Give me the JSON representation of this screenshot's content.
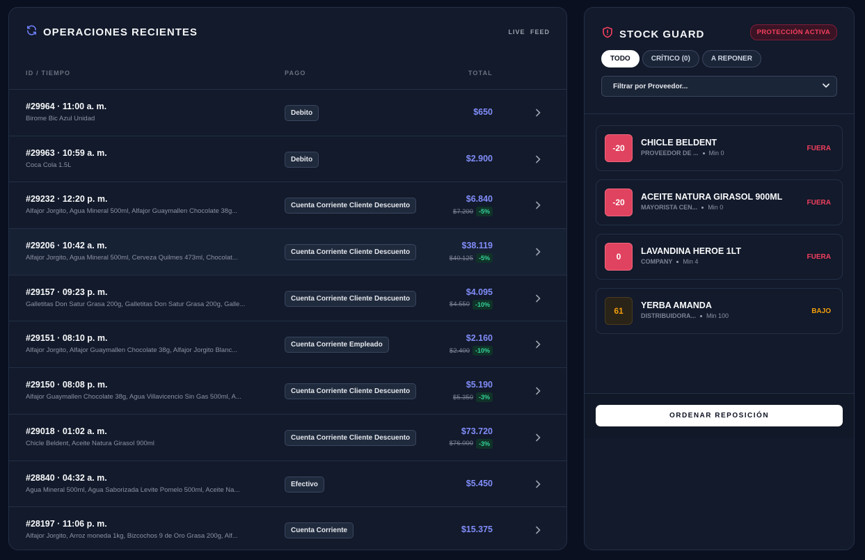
{
  "operations": {
    "title": "OPERACIONES RECIENTES",
    "live_label": "LIVE FEED",
    "columns": {
      "id_time": "ID / TIEMPO",
      "payment": "PAGO",
      "total": "TOTAL"
    },
    "rows": [
      {
        "id_time": "#29964 · 11:00 a. m.",
        "items": "Birome Bic Azul Unidad",
        "payment": "Debito",
        "total": "$650",
        "old": "",
        "discount": ""
      },
      {
        "id_time": "#29963 · 10:59 a. m.",
        "items": "Coca Cola 1.5L",
        "payment": "Debito",
        "total": "$2.900",
        "old": "",
        "discount": ""
      },
      {
        "id_time": "#29232 · 12:20 p. m.",
        "items": "Alfajor Jorgito, Agua Mineral 500ml, Alfajor Guaymallen Chocolate 38g...",
        "payment": "Cuenta Corriente Cliente Descuento",
        "total": "$6.840",
        "old": "$7.200",
        "discount": "-5%"
      },
      {
        "id_time": "#29206 · 10:42 a. m.",
        "items": "Alfajor Jorgito, Agua Mineral 500ml, Cerveza Quilmes 473ml, Chocolat...",
        "payment": "Cuenta Corriente Cliente Descuento",
        "total": "$38.119",
        "old": "$40.125",
        "discount": "-5%"
      },
      {
        "id_time": "#29157 · 09:23 p. m.",
        "items": "Galletitas Don Satur Grasa 200g, Galletitas Don Satur Grasa 200g, Galle...",
        "payment": "Cuenta Corriente Cliente Descuento",
        "total": "$4.095",
        "old": "$4.550",
        "discount": "-10%"
      },
      {
        "id_time": "#29151 · 08:10 p. m.",
        "items": "Alfajor Jorgito, Alfajor Guaymallen Chocolate 38g, Alfajor Jorgito Blanc...",
        "payment": "Cuenta Corriente Empleado",
        "total": "$2.160",
        "old": "$2.400",
        "discount": "-10%"
      },
      {
        "id_time": "#29150 · 08:08 p. m.",
        "items": "Alfajor Guaymallen Chocolate 38g, Agua Villavicencio Sin Gas 500ml, A...",
        "payment": "Cuenta Corriente Cliente Descuento",
        "total": "$5.190",
        "old": "$5.350",
        "discount": "-3%"
      },
      {
        "id_time": "#29018 · 01:02 a. m.",
        "items": "Chicle Beldent, Aceite Natura Girasol 900ml",
        "payment": "Cuenta Corriente Cliente Descuento",
        "total": "$73.720",
        "old": "$76.000",
        "discount": "-3%"
      },
      {
        "id_time": "#28840 · 04:32 a. m.",
        "items": "Agua Mineral 500ml, Agua Saborizada Levite Pomelo 500ml, Aceite Na...",
        "payment": "Efectivo",
        "total": "$5.450",
        "old": "",
        "discount": ""
      },
      {
        "id_time": "#28197 · 11:06 p. m.",
        "items": "Alfajor Jorgito, Arroz moneda 1kg, Bizcochos 9 de Oro Grasa 200g, Alf...",
        "payment": "Cuenta Corriente",
        "total": "$15.375",
        "old": "",
        "discount": ""
      }
    ]
  },
  "stock_guard": {
    "title": "STOCK GUARD",
    "badge": "PROTECCIÓN ACTIVA",
    "tabs": [
      "TODO",
      "CRÍTICO (0)",
      "A REPONER"
    ],
    "filter_placeholder": "Filtrar por Proveedor...",
    "items": [
      {
        "qty": "-20",
        "name": "CHICLE BELDENT",
        "supplier": "PROVEEDOR DE ...",
        "min": "Min 0",
        "status": "FUERA",
        "level": "out"
      },
      {
        "qty": "-20",
        "name": "ACEITE NATURA GIRASOL 900ML",
        "supplier": "MAYORISTA CEN...",
        "min": "Min 0",
        "status": "FUERA",
        "level": "out"
      },
      {
        "qty": "0",
        "name": "LAVANDINA HEROE 1LT",
        "supplier": "COMPANY",
        "min": "Min 4",
        "status": "FUERA",
        "level": "out"
      },
      {
        "qty": "61",
        "name": "YERBA AMANDA",
        "supplier": "DISTRIBUIDORA...",
        "min": "Min 100",
        "status": "BAJO",
        "level": "low"
      }
    ],
    "order_button": "ORDENAR REPOSICIÓN"
  },
  "colors": {
    "accent": "#818cf8",
    "danger": "#f43f5e",
    "warning": "#f59e0b",
    "success": "#34d399"
  },
  "icons": {
    "operations": "refresh-icon",
    "stock_guard": "shield-alert-icon",
    "row_action": "chevron-right-icon",
    "select": "chevron-down-icon"
  }
}
